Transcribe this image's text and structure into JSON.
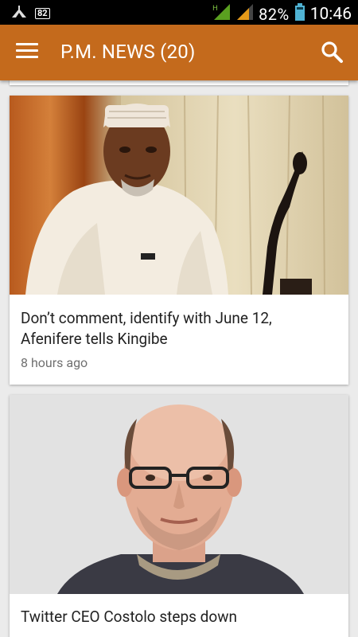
{
  "status_bar": {
    "notification_count": "82",
    "network_type": "H",
    "battery_percent": "82%",
    "time": "10:46"
  },
  "app_bar": {
    "title": "P.M. NEWS (20)",
    "background_color": "#c46a1c"
  },
  "articles": [
    {
      "title": "Don’t comment, identify with June 12, Afenifere tells Kingibe",
      "time": "8 hours ago",
      "image": "man-in-white-agbada-and-cap"
    },
    {
      "title": "Twitter CEO Costolo steps down",
      "image": "bald-man-with-glasses-portrait"
    }
  ]
}
